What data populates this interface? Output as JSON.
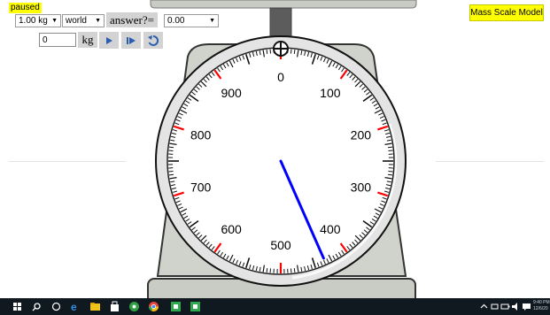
{
  "status": {
    "label": "paused"
  },
  "title": {
    "label": "Mass Scale Model"
  },
  "toolbar": {
    "mass_select": "1.00 kg",
    "frame_select": "world",
    "answer_label": "answer?=",
    "answer_select": "0.00",
    "mass_input_value": "0",
    "unit_label": "kg"
  },
  "dial": {
    "labels": [
      "0",
      "100",
      "200",
      "300",
      "400",
      "500",
      "600",
      "700",
      "800",
      "900"
    ],
    "needle_reading": 434,
    "needle_color": "#0000ff",
    "major_tick_color": "#ff0000"
  },
  "taskbar": {
    "time": "9:40 PM",
    "date": "12/6/20"
  }
}
